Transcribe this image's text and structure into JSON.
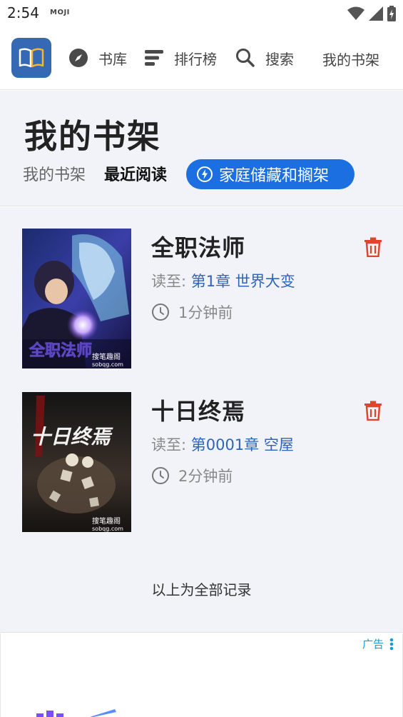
{
  "status_bar": {
    "time": "2:54",
    "carrier_logo": "MOJI",
    "icons": [
      "wifi-icon",
      "signal-icon",
      "battery-charging-icon"
    ]
  },
  "navbar": {
    "logo_icon": "open-book-icon",
    "items": [
      {
        "label": "书库",
        "icon": "compass-icon"
      },
      {
        "label": "排行榜",
        "icon": "ranking-bars-icon"
      },
      {
        "label": "搜索",
        "icon": "search-icon"
      }
    ],
    "my_shelf": "我的书架"
  },
  "page": {
    "title": "我的书架",
    "tabs": {
      "shelf": "我的书架",
      "recent": "最近阅读"
    },
    "family_button": "家庭储藏和搁架"
  },
  "books": [
    {
      "title": "全职法师",
      "read_prefix": "读至: ",
      "chapter": "第1章 世界大变",
      "time": "1分钟前",
      "cover_text": "全职法师",
      "cover_watermark": "搜笔趣阁",
      "cover_site": "sobqg.com"
    },
    {
      "title": "十日终焉",
      "read_prefix": "读至: ",
      "chapter": "第0001章 空屋",
      "time": "2分钟前",
      "cover_text": "十日终焉",
      "cover_watermark": "搜笔趣阁",
      "cover_site": "sobqg.com"
    }
  ],
  "end_text": "以上为全部记录",
  "ad": {
    "label": "广告"
  },
  "colors": {
    "accent": "#1c6fe0",
    "logo_bg": "#3569b3",
    "delete": "#e0452c",
    "chapter_link": "#2f64b8",
    "page_bg": "#f2f3f8"
  }
}
